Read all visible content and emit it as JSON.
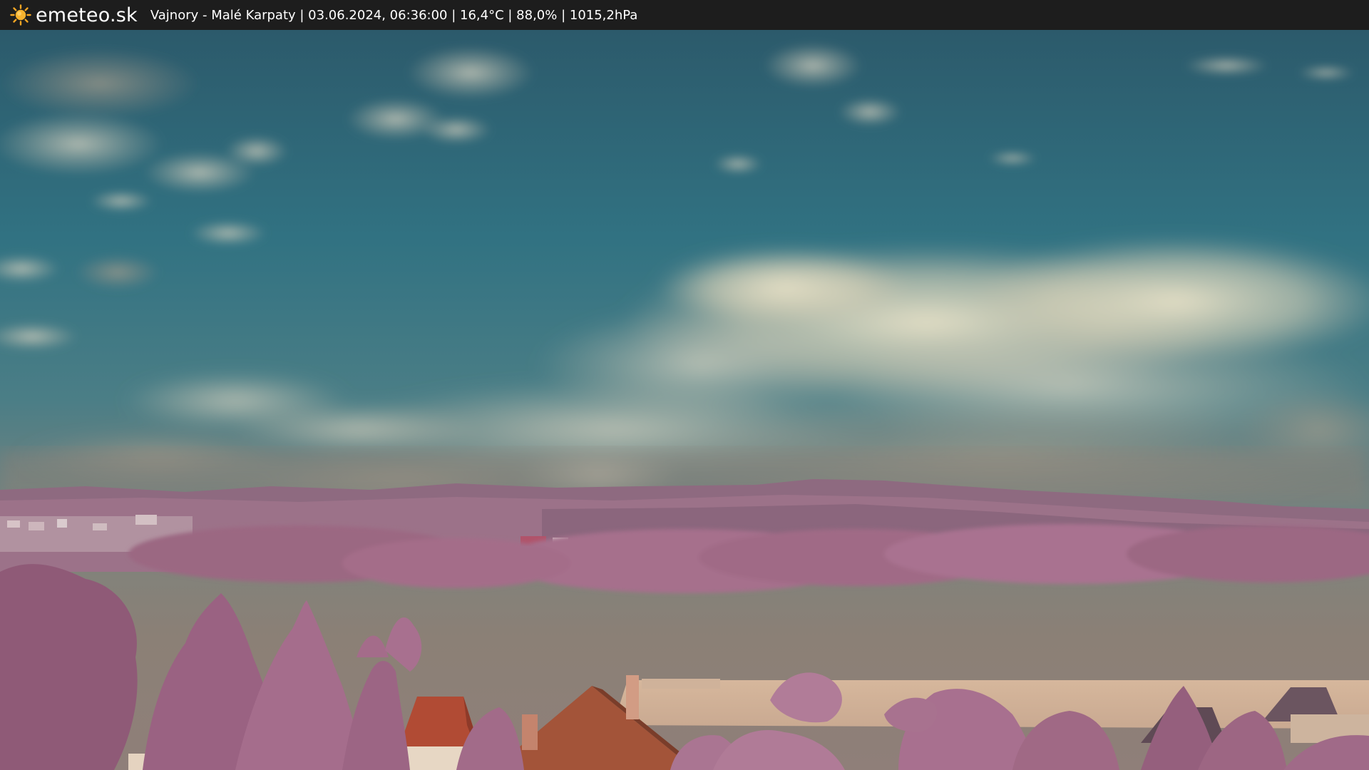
{
  "header": {
    "site_name": "emeteo.sk",
    "caption": "Vajnory - Malé Karpaty | 03.06.2024, 06:36:00 | 16,4°C | 88,0% | 1015,2hPa",
    "logo_icon": "sun-icon"
  },
  "colors": {
    "bar_background": "#1d1d1d",
    "sun": "#f5a623",
    "sky_top": "#2e6172",
    "sky_horizon": "#8a8074",
    "cloud": "#e6dfc6",
    "foliage": "#a8708c",
    "roof": "#a14a32"
  }
}
